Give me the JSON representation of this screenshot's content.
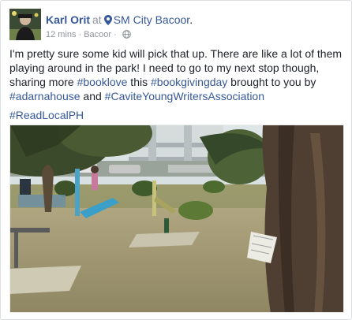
{
  "post": {
    "author": "Karl Orit",
    "at_word": "at",
    "place": "SM City Bacoor",
    "time": "12 mins",
    "location": "Bacoor",
    "privacy_icon": "globe-icon",
    "location_icon": "map-pin-icon",
    "text_segments": [
      "I'm pretty sure some kid will pick that up. There are like a lot of them playing around in the park! I need to go to my next stop though, sharing more ",
      "#booklove",
      " this ",
      "#bookgivingday",
      " brought to you by ",
      "#adarnahouse",
      " and ",
      "#CaviteYoungWritersAssociation"
    ],
    "hashtag_line": "#ReadLocalPH",
    "photo_description_icon": "park-photo"
  },
  "colors": {
    "link": "#365899",
    "text": "#1d2129",
    "meta": "#90949c"
  }
}
